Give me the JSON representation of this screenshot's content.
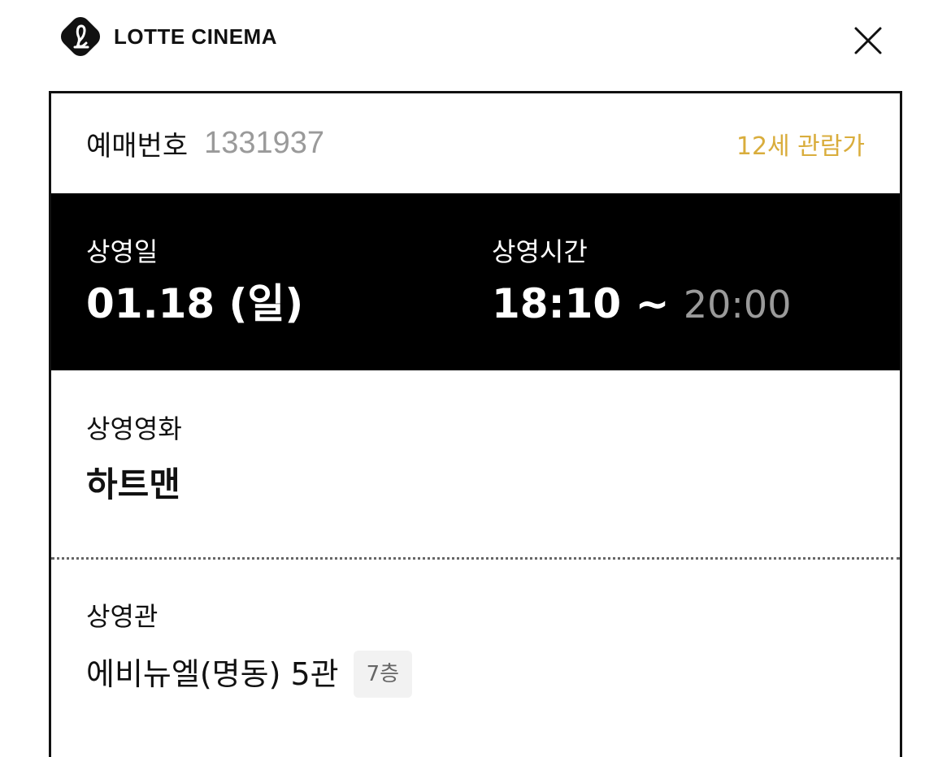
{
  "header": {
    "brand": "LOTTE CINEMA",
    "logo_icon": "lotte-l-logo-icon",
    "close_icon": "close-icon"
  },
  "booking": {
    "label": "예매번호",
    "number": "1331937",
    "rating": "12세 관람가",
    "rating_color": "#d9ad3c"
  },
  "schedule": {
    "date_label": "상영일",
    "date_value": "01.18 (일)",
    "time_label": "상영시간",
    "time_start": "18:10 ~",
    "time_end": "20:00"
  },
  "movie": {
    "label": "상영영화",
    "title": "하트맨"
  },
  "theater": {
    "label": "상영관",
    "name": "에비뉴엘(명동) 5관",
    "floor": "7층"
  }
}
